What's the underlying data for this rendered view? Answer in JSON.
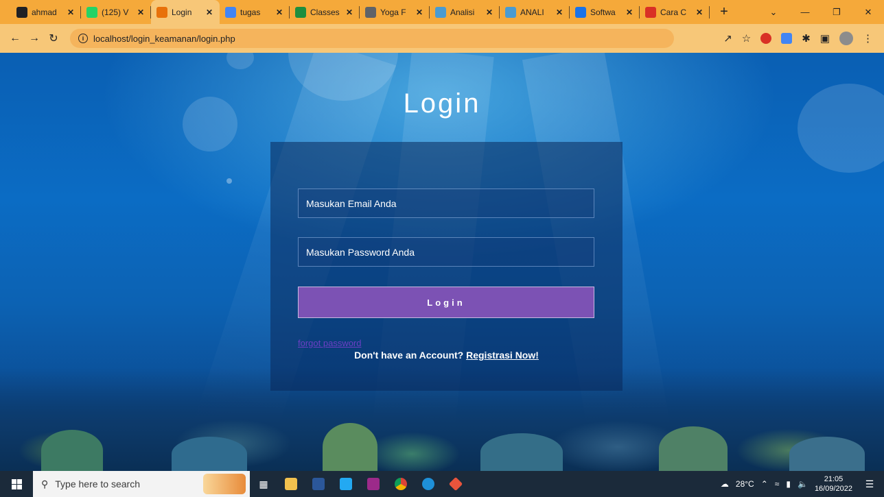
{
  "browser": {
    "tabs": [
      {
        "title": "ahmad",
        "favicon": "github-icon",
        "color": "#202124"
      },
      {
        "title": "(125) V",
        "favicon": "whatsapp-icon",
        "color": "#25d366"
      },
      {
        "title": "Login",
        "favicon": "login-page-icon",
        "color": "#e8710a",
        "active": true
      },
      {
        "title": "tugas",
        "favicon": "google-icon",
        "color": "#4285f4"
      },
      {
        "title": "Classes",
        "favicon": "classroom-icon",
        "color": "#1e8e3e"
      },
      {
        "title": "Yoga F",
        "favicon": "globe-icon",
        "color": "#5f6368"
      },
      {
        "title": "Analisi",
        "favicon": "network-icon",
        "color": "#4a9bd1"
      },
      {
        "title": "ANALI",
        "favicon": "network-icon",
        "color": "#4a9bd1"
      },
      {
        "title": "Softwa",
        "favicon": "software-icon",
        "color": "#1a73e8"
      },
      {
        "title": "Cara C",
        "favicon": "opera-icon",
        "color": "#d93025"
      }
    ],
    "new_tab_label": "+",
    "url": "localhost/login_keamanan/login.php"
  },
  "page": {
    "title": "Login",
    "email_placeholder": "Masukan Email Anda",
    "password_placeholder": "Masukan Password Anda",
    "login_button": "Login",
    "forgot_password": "forgot password",
    "signup_prompt": "Don't have an Account?",
    "signup_link": "Registrasi Now!"
  },
  "taskbar": {
    "search_placeholder": "Type here to search",
    "weather": "28°C",
    "time": "21:05",
    "date": "16/09/2022"
  }
}
